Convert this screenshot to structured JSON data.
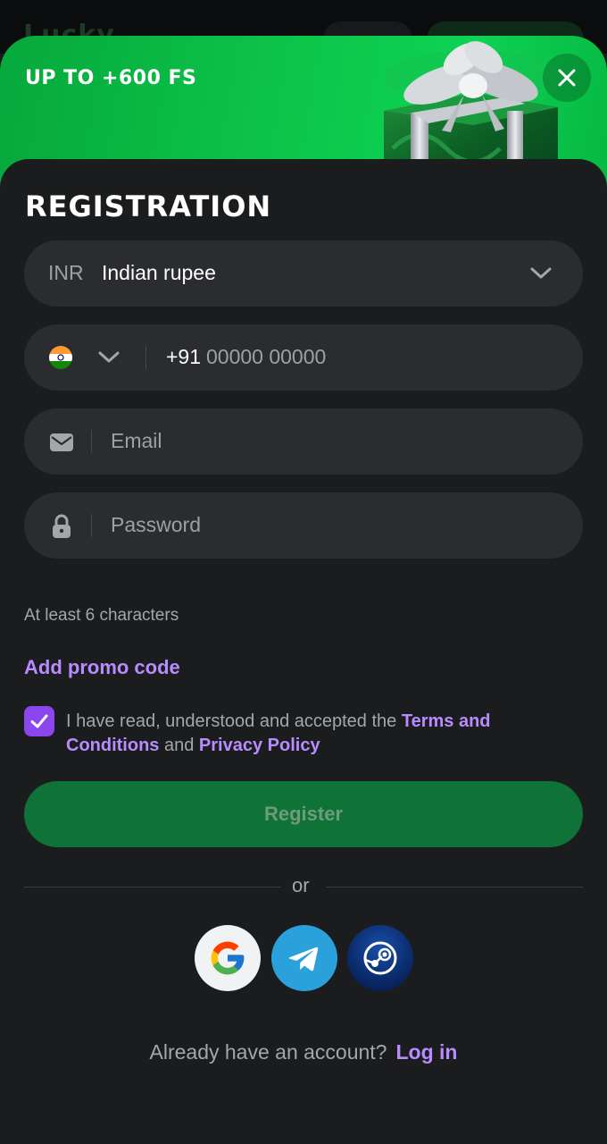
{
  "background": {
    "logo": "Lucky"
  },
  "banner": {
    "title": "UP TO +600 FS"
  },
  "form": {
    "title": "REGISTRATION",
    "currency": {
      "code": "INR",
      "name": "Indian rupee"
    },
    "phone": {
      "country_code": "+91",
      "placeholder": "00000 00000"
    },
    "email": {
      "placeholder": "Email"
    },
    "password": {
      "placeholder": "Password",
      "hint": "At least 6 characters"
    },
    "promo_label": "Add promo code",
    "terms": {
      "checked": true,
      "prefix": "I have read, understood and accepted the ",
      "terms_link": "Terms and Conditions",
      "middle": " and ",
      "privacy_link": "Privacy Policy"
    },
    "register_label": "Register",
    "or_label": "or"
  },
  "footer": {
    "question": "Already have an account?",
    "login_label": "Log in"
  },
  "colors": {
    "accent": "#b88cff",
    "checkbox": "#8b46f0",
    "register": "#0f7236",
    "banner": "#0cc449"
  },
  "icons": [
    "close-icon",
    "gift-image",
    "chevron-down-icon",
    "india-flag-icon",
    "mail-icon",
    "lock-icon",
    "check-icon",
    "google-icon",
    "telegram-icon",
    "steam-icon"
  ]
}
